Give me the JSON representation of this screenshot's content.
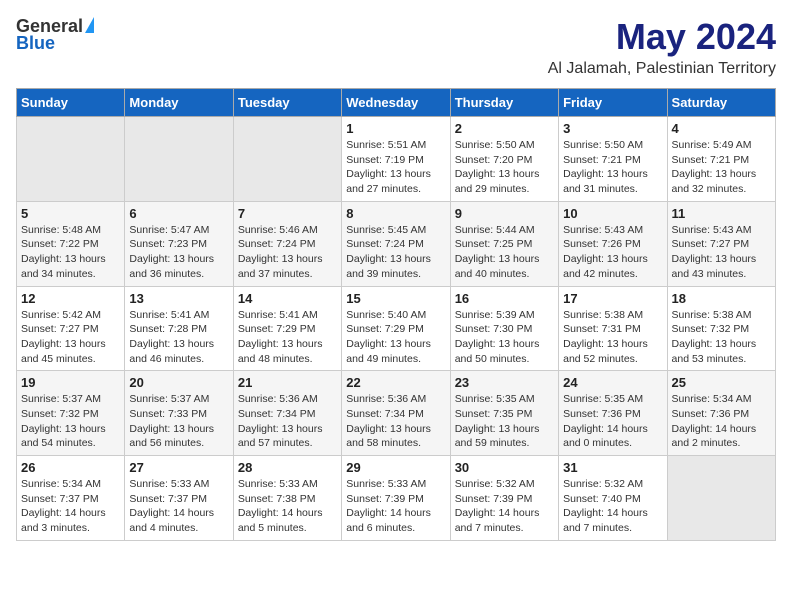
{
  "logo": {
    "general": "General",
    "blue": "Blue"
  },
  "title": {
    "month": "May 2024",
    "location": "Al Jalamah, Palestinian Territory"
  },
  "headers": [
    "Sunday",
    "Monday",
    "Tuesday",
    "Wednesday",
    "Thursday",
    "Friday",
    "Saturday"
  ],
  "weeks": [
    [
      {
        "day": "",
        "sunrise": "",
        "sunset": "",
        "daylight": ""
      },
      {
        "day": "",
        "sunrise": "",
        "sunset": "",
        "daylight": ""
      },
      {
        "day": "",
        "sunrise": "",
        "sunset": "",
        "daylight": ""
      },
      {
        "day": "1",
        "sunrise": "Sunrise: 5:51 AM",
        "sunset": "Sunset: 7:19 PM",
        "daylight": "Daylight: 13 hours and 27 minutes."
      },
      {
        "day": "2",
        "sunrise": "Sunrise: 5:50 AM",
        "sunset": "Sunset: 7:20 PM",
        "daylight": "Daylight: 13 hours and 29 minutes."
      },
      {
        "day": "3",
        "sunrise": "Sunrise: 5:50 AM",
        "sunset": "Sunset: 7:21 PM",
        "daylight": "Daylight: 13 hours and 31 minutes."
      },
      {
        "day": "4",
        "sunrise": "Sunrise: 5:49 AM",
        "sunset": "Sunset: 7:21 PM",
        "daylight": "Daylight: 13 hours and 32 minutes."
      }
    ],
    [
      {
        "day": "5",
        "sunrise": "Sunrise: 5:48 AM",
        "sunset": "Sunset: 7:22 PM",
        "daylight": "Daylight: 13 hours and 34 minutes."
      },
      {
        "day": "6",
        "sunrise": "Sunrise: 5:47 AM",
        "sunset": "Sunset: 7:23 PM",
        "daylight": "Daylight: 13 hours and 36 minutes."
      },
      {
        "day": "7",
        "sunrise": "Sunrise: 5:46 AM",
        "sunset": "Sunset: 7:24 PM",
        "daylight": "Daylight: 13 hours and 37 minutes."
      },
      {
        "day": "8",
        "sunrise": "Sunrise: 5:45 AM",
        "sunset": "Sunset: 7:24 PM",
        "daylight": "Daylight: 13 hours and 39 minutes."
      },
      {
        "day": "9",
        "sunrise": "Sunrise: 5:44 AM",
        "sunset": "Sunset: 7:25 PM",
        "daylight": "Daylight: 13 hours and 40 minutes."
      },
      {
        "day": "10",
        "sunrise": "Sunrise: 5:43 AM",
        "sunset": "Sunset: 7:26 PM",
        "daylight": "Daylight: 13 hours and 42 minutes."
      },
      {
        "day": "11",
        "sunrise": "Sunrise: 5:43 AM",
        "sunset": "Sunset: 7:27 PM",
        "daylight": "Daylight: 13 hours and 43 minutes."
      }
    ],
    [
      {
        "day": "12",
        "sunrise": "Sunrise: 5:42 AM",
        "sunset": "Sunset: 7:27 PM",
        "daylight": "Daylight: 13 hours and 45 minutes."
      },
      {
        "day": "13",
        "sunrise": "Sunrise: 5:41 AM",
        "sunset": "Sunset: 7:28 PM",
        "daylight": "Daylight: 13 hours and 46 minutes."
      },
      {
        "day": "14",
        "sunrise": "Sunrise: 5:41 AM",
        "sunset": "Sunset: 7:29 PM",
        "daylight": "Daylight: 13 hours and 48 minutes."
      },
      {
        "day": "15",
        "sunrise": "Sunrise: 5:40 AM",
        "sunset": "Sunset: 7:29 PM",
        "daylight": "Daylight: 13 hours and 49 minutes."
      },
      {
        "day": "16",
        "sunrise": "Sunrise: 5:39 AM",
        "sunset": "Sunset: 7:30 PM",
        "daylight": "Daylight: 13 hours and 50 minutes."
      },
      {
        "day": "17",
        "sunrise": "Sunrise: 5:38 AM",
        "sunset": "Sunset: 7:31 PM",
        "daylight": "Daylight: 13 hours and 52 minutes."
      },
      {
        "day": "18",
        "sunrise": "Sunrise: 5:38 AM",
        "sunset": "Sunset: 7:32 PM",
        "daylight": "Daylight: 13 hours and 53 minutes."
      }
    ],
    [
      {
        "day": "19",
        "sunrise": "Sunrise: 5:37 AM",
        "sunset": "Sunset: 7:32 PM",
        "daylight": "Daylight: 13 hours and 54 minutes."
      },
      {
        "day": "20",
        "sunrise": "Sunrise: 5:37 AM",
        "sunset": "Sunset: 7:33 PM",
        "daylight": "Daylight: 13 hours and 56 minutes."
      },
      {
        "day": "21",
        "sunrise": "Sunrise: 5:36 AM",
        "sunset": "Sunset: 7:34 PM",
        "daylight": "Daylight: 13 hours and 57 minutes."
      },
      {
        "day": "22",
        "sunrise": "Sunrise: 5:36 AM",
        "sunset": "Sunset: 7:34 PM",
        "daylight": "Daylight: 13 hours and 58 minutes."
      },
      {
        "day": "23",
        "sunrise": "Sunrise: 5:35 AM",
        "sunset": "Sunset: 7:35 PM",
        "daylight": "Daylight: 13 hours and 59 minutes."
      },
      {
        "day": "24",
        "sunrise": "Sunrise: 5:35 AM",
        "sunset": "Sunset: 7:36 PM",
        "daylight": "Daylight: 14 hours and 0 minutes."
      },
      {
        "day": "25",
        "sunrise": "Sunrise: 5:34 AM",
        "sunset": "Sunset: 7:36 PM",
        "daylight": "Daylight: 14 hours and 2 minutes."
      }
    ],
    [
      {
        "day": "26",
        "sunrise": "Sunrise: 5:34 AM",
        "sunset": "Sunset: 7:37 PM",
        "daylight": "Daylight: 14 hours and 3 minutes."
      },
      {
        "day": "27",
        "sunrise": "Sunrise: 5:33 AM",
        "sunset": "Sunset: 7:37 PM",
        "daylight": "Daylight: 14 hours and 4 minutes."
      },
      {
        "day": "28",
        "sunrise": "Sunrise: 5:33 AM",
        "sunset": "Sunset: 7:38 PM",
        "daylight": "Daylight: 14 hours and 5 minutes."
      },
      {
        "day": "29",
        "sunrise": "Sunrise: 5:33 AM",
        "sunset": "Sunset: 7:39 PM",
        "daylight": "Daylight: 14 hours and 6 minutes."
      },
      {
        "day": "30",
        "sunrise": "Sunrise: 5:32 AM",
        "sunset": "Sunset: 7:39 PM",
        "daylight": "Daylight: 14 hours and 7 minutes."
      },
      {
        "day": "31",
        "sunrise": "Sunrise: 5:32 AM",
        "sunset": "Sunset: 7:40 PM",
        "daylight": "Daylight: 14 hours and 7 minutes."
      },
      {
        "day": "",
        "sunrise": "",
        "sunset": "",
        "daylight": ""
      }
    ]
  ]
}
